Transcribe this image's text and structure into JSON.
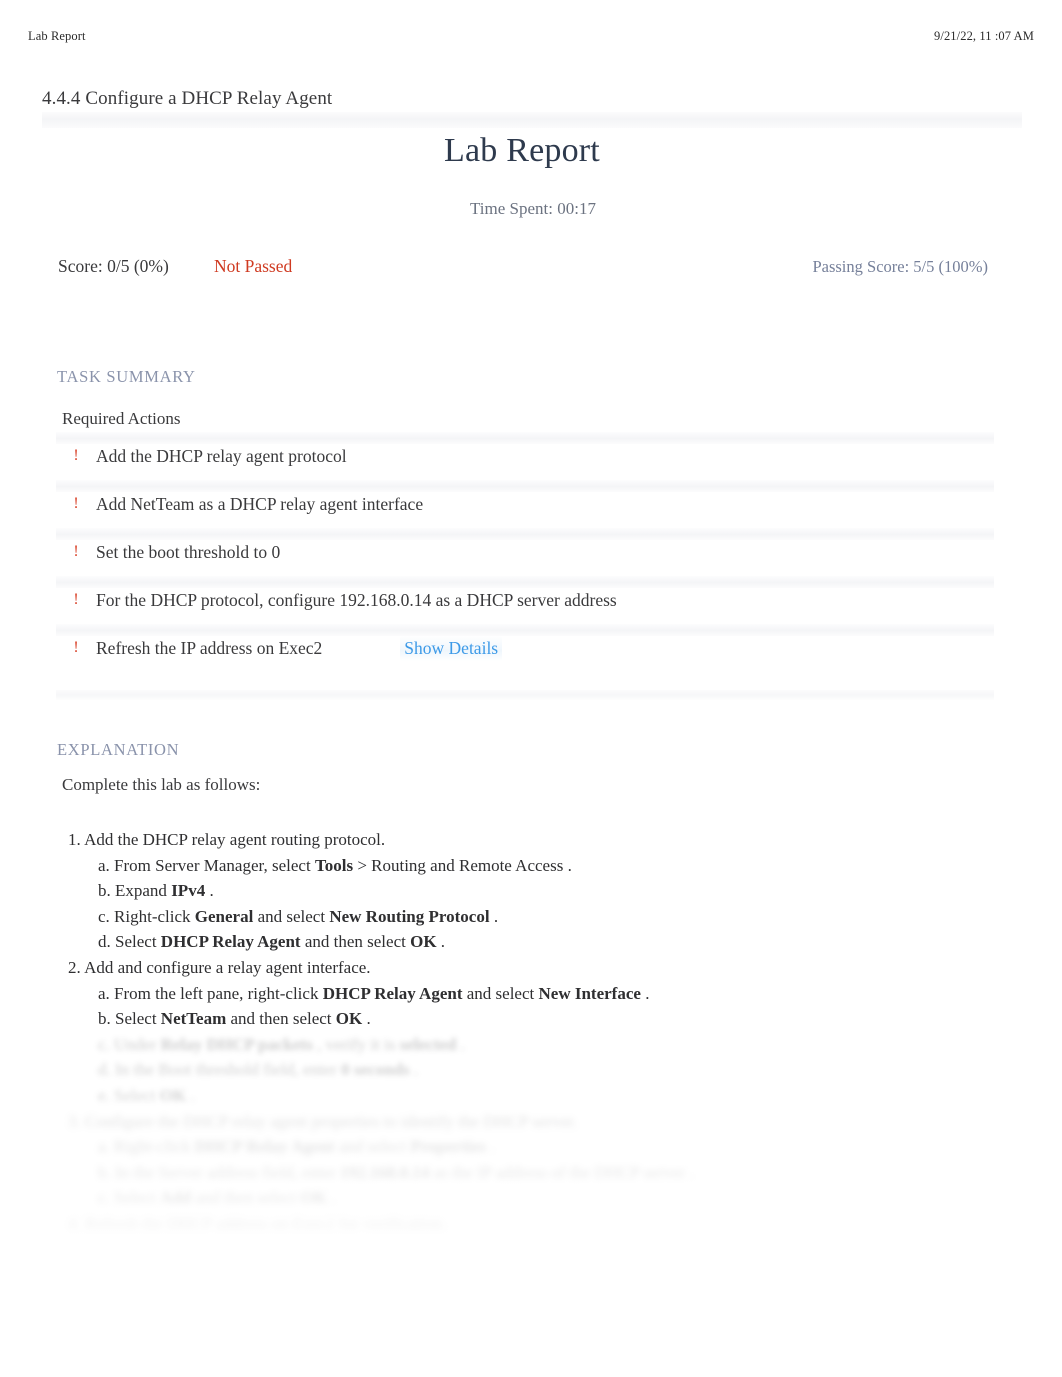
{
  "print_header": {
    "left_label": "Lab Report",
    "timestamp": "9/21/22, 11 :07 AM"
  },
  "lab": {
    "number_and_title": "4.4.4 Configure a DHCP Relay Agent",
    "report_title": "Lab Report",
    "time_spent_label": "Time Spent: 00:17"
  },
  "score": {
    "score_text": "Score: 0/5 (0%)",
    "pass_state": "Not Passed",
    "pass_state_color": "#cf3a21",
    "passing_score": "Passing Score: 5/5 (100%)"
  },
  "task_summary": {
    "heading": "TASK SUMMARY",
    "subheading": "Required Actions",
    "marker_glyph": "!",
    "marker_color": "#d9432a",
    "items": [
      {
        "text": "Add the DHCP relay agent protocol",
        "link": ""
      },
      {
        "text": "Add NetTeam as a DHCP relay agent interface",
        "link": ""
      },
      {
        "text": "Set the boot threshold to 0",
        "link": ""
      },
      {
        "text": "For the DHCP protocol, configure 192.168.0.14 as a DHCP server address",
        "link": ""
      },
      {
        "text": "Refresh the IP address on Exec2",
        "link": "Show Details"
      }
    ],
    "link_color": "#3d9ae8"
  },
  "explanation": {
    "heading": "EXPLANATION",
    "intro": "Complete this lab as follows:",
    "steps": [
      {
        "num": "1.",
        "text": "Add the DHCP relay agent routing protocol.",
        "level": 1,
        "blur": 0
      },
      {
        "num": "a.",
        "pre": "From Server Manager, select",
        "ui1": "Tools",
        "mid": "> Routing and Remote Access",
        "post": ".",
        "level": 2,
        "blur": 0
      },
      {
        "num": "b.",
        "pre": "Expand",
        "ui1": "IPv4",
        "post": ".",
        "level": 2,
        "blur": 0
      },
      {
        "num": "c.",
        "pre": "Right-click",
        "ui1": "General",
        "mid": "and select",
        "ui2": "New Routing Protocol",
        "post": ".",
        "level": 2,
        "blur": 0
      },
      {
        "num": "d.",
        "pre": "Select",
        "ui1": "DHCP Relay Agent",
        "mid": "and then select",
        "ui2": "OK",
        "post": ".",
        "level": 2,
        "blur": 0
      },
      {
        "num": "2.",
        "text": "Add and configure a relay agent interface.",
        "level": 1,
        "blur": 0
      },
      {
        "num": "a.",
        "pre": "From the left pane, right-click",
        "ui1": "DHCP Relay Agent",
        "mid": "and select",
        "ui2": "New Interface",
        "post": ".",
        "level": 2,
        "blur": 0
      },
      {
        "num": "b.",
        "pre": "Select",
        "ui1": "NetTeam",
        "mid": "and then select",
        "ui2": "OK",
        "post": ".",
        "level": 2,
        "blur": 0
      },
      {
        "num": "c.",
        "pre": "Under",
        "ui1": "Relay DHCP packets",
        "mid": ", verify it is",
        "ui2": "selected",
        "post": ".",
        "level": 2,
        "blur": 1
      },
      {
        "num": "d.",
        "pre": "In the Boot threshold field, enter",
        "ui1": "0 seconds",
        "post": ".",
        "level": 2,
        "blur": 1
      },
      {
        "num": "e.",
        "pre": "Select",
        "ui1": "OK",
        "post": ".",
        "level": 2,
        "blur": 1
      },
      {
        "num": "3.",
        "text": "Configure the DHCP relay agent properties to identify the DHCP server.",
        "level": 1,
        "blur": 2
      },
      {
        "num": "a.",
        "pre": "Right-click",
        "ui1": "DHCP Relay Agent",
        "mid": "and select",
        "ui2": "Properties",
        "post": ".",
        "level": 2,
        "blur": 2
      },
      {
        "num": "b.",
        "pre": "In the Server address field, enter",
        "ui1": "192.168.0.14",
        "mid": "as the IP address of the DHCP server",
        "post": ".",
        "level": 2,
        "blur": 2
      },
      {
        "num": "c.",
        "pre": "Select",
        "ui1": "Add",
        "mid": "and then select",
        "ui2": "OK",
        "post": ".",
        "level": 2,
        "blur": 2
      },
      {
        "num": "4.",
        "text": "Refresh the DHCP address on Exec2 for verification.",
        "level": 1,
        "blur": 3
      }
    ]
  }
}
